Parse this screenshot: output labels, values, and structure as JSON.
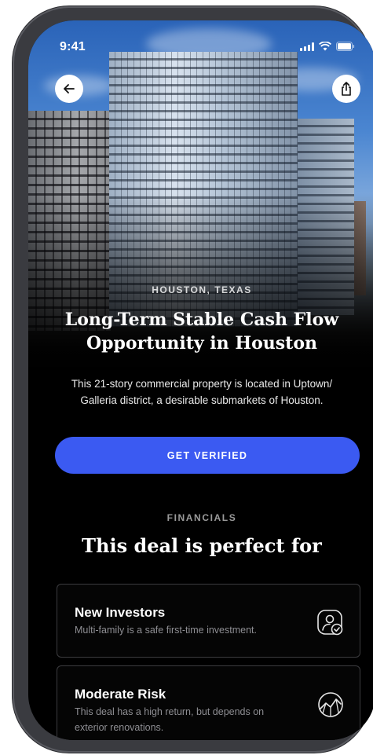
{
  "status_bar": {
    "time": "9:41"
  },
  "nav": {
    "back_icon": "arrow-left-icon",
    "share_icon": "share-icon"
  },
  "property": {
    "location": "HOUSTON, TEXAS",
    "title": "Long-Term Stable Cash Flow Opportunity in Houston",
    "description": "This 21-story commercial property is located in Uptown/ Galleria district, a desirable submarkets of Houston."
  },
  "cta": {
    "label": "GET VERIFIED",
    "color": "#3b5af2"
  },
  "financials": {
    "label": "FINANCIALS",
    "title": "This deal is perfect for",
    "cards": [
      {
        "title": "New Investors",
        "text": "Multi-family is a safe first-time investment.",
        "icon": "user-check-icon"
      },
      {
        "title": "Moderate Risk",
        "text": "This deal has a high return, but depends on exterior renovations.",
        "icon": "chart-globe-icon"
      }
    ]
  }
}
